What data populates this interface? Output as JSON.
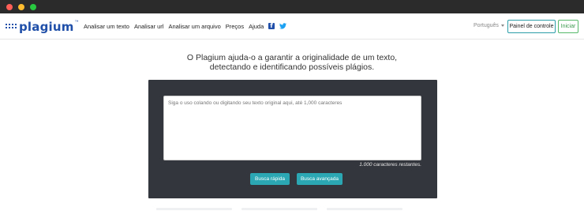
{
  "window": {
    "controls": [
      "close",
      "minimize",
      "maximize"
    ]
  },
  "nav": {
    "logo_text": "plagium",
    "logo_tm": "™",
    "links": [
      "Analisar um texto",
      "Analisar url",
      "Analisar um arquivo",
      "Preços",
      "Ajuda"
    ],
    "social_icons": [
      "facebook-icon",
      "twitter-icon"
    ],
    "language": "Português",
    "panel_button": "Painel de controle",
    "start_button": "Iniciar"
  },
  "hero": {
    "line1": "O Plagium ajuda-o a garantir a originalidade de um texto,",
    "line2": "detectando e identificando possíveis plágios."
  },
  "checker": {
    "placeholder": "Siga o uso colando ou digitando seu texto original aqui, até 1,000 caracteres",
    "remaining": "1.000 caracteres restantes.",
    "quick_button": "Busca rápida",
    "advanced_button": "Busca avançada"
  },
  "colors": {
    "brand": "#1f4fa8",
    "accent": "#2aa7b2",
    "panel_bg": "#33363c",
    "start_green": "#56b96a"
  }
}
